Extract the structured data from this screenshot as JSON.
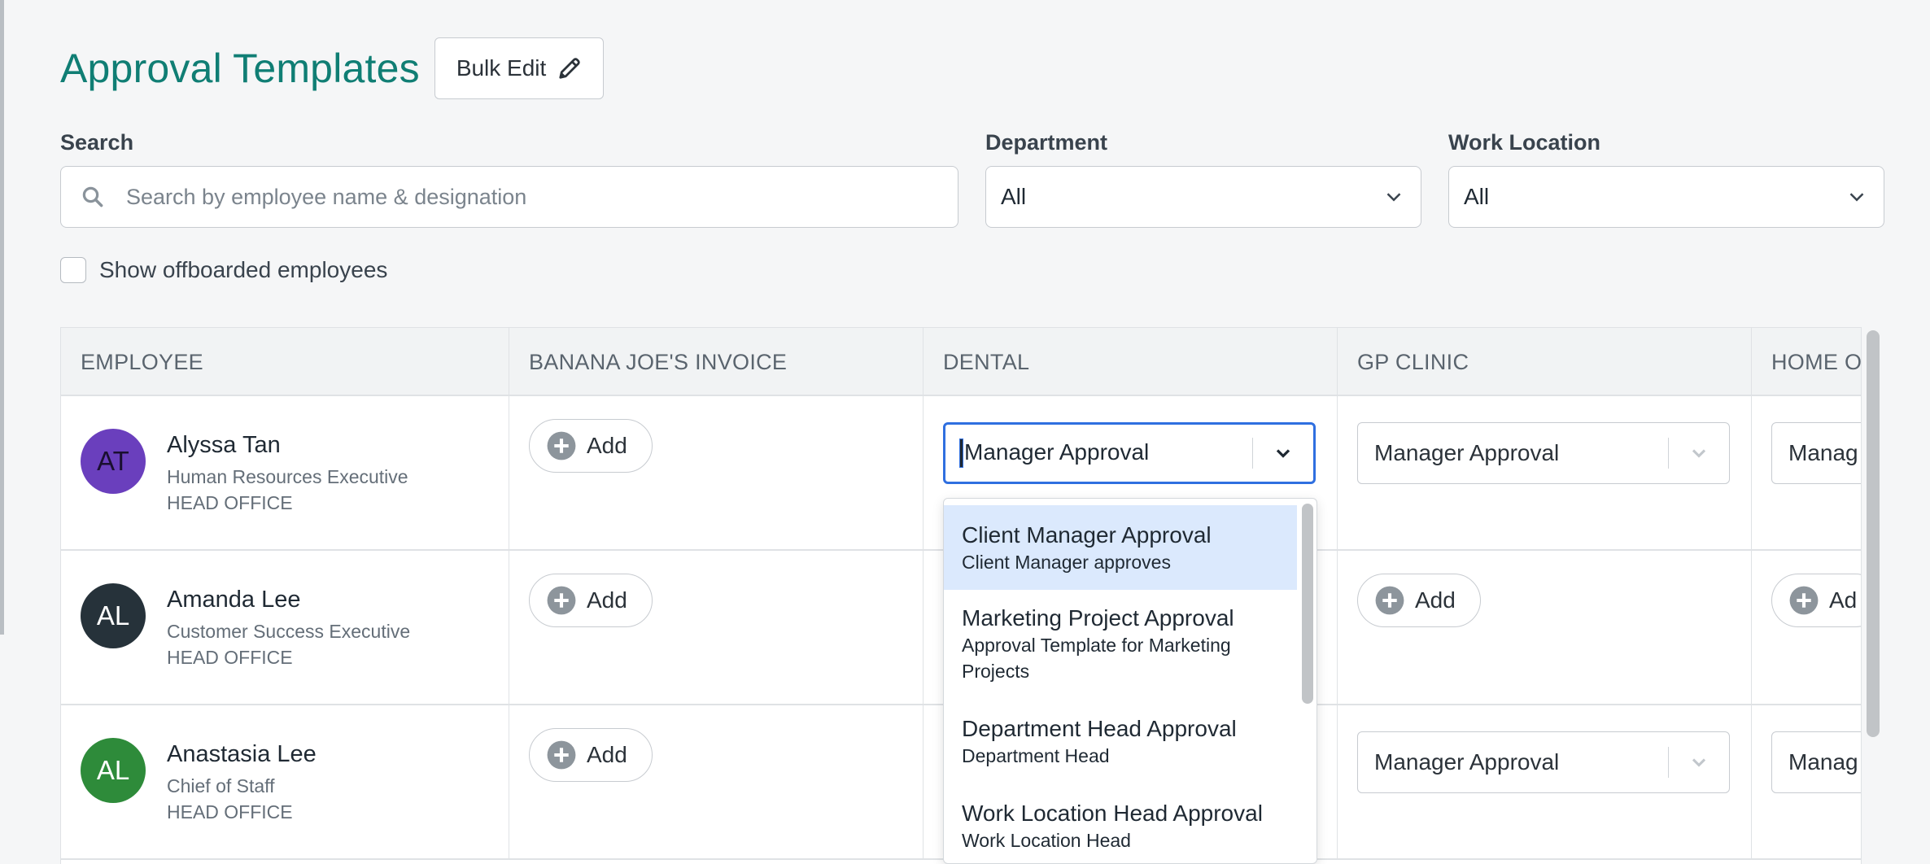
{
  "header": {
    "title": "Approval Templates",
    "bulk_edit_label": "Bulk Edit"
  },
  "filters": {
    "search_label": "Search",
    "search_placeholder": "Search by employee name & designation",
    "department_label": "Department",
    "department_value": "All",
    "work_location_label": "Work Location",
    "work_location_value": "All",
    "offboarded_label": "Show offboarded employees"
  },
  "table": {
    "columns": [
      "EMPLOYEE",
      "BANANA JOE'S INVOICE",
      "DENTAL",
      "GP CLINIC",
      "HOME OF"
    ],
    "add_label": "Add",
    "rows": [
      {
        "initials": "AT",
        "avatar_color": "#6a3fbd",
        "name": "Alyssa Tan",
        "title": "Human Resources Executive",
        "location": "HEAD OFFICE",
        "dental": "Manager Approval",
        "gp_clinic": "Manager Approval",
        "home_office": "Manag"
      },
      {
        "initials": "AL",
        "avatar_color": "#26323a",
        "name": "Amanda Lee",
        "title": "Customer Success Executive",
        "location": "HEAD OFFICE",
        "home_office_add": "Ad"
      },
      {
        "initials": "AL",
        "avatar_color": "#2e8b3a",
        "name": "Anastasia Lee",
        "title": "Chief of Staff",
        "location": "HEAD OFFICE",
        "gp_clinic": "Manager Approval",
        "home_office": "Manag"
      }
    ]
  },
  "dropdown": {
    "options": [
      {
        "title": "Client Manager Approval",
        "subtitle": "Client Manager approves"
      },
      {
        "title": "Marketing Project Approval",
        "subtitle_line1": "Approval Template for Marketing",
        "subtitle_line2": "Projects"
      },
      {
        "title": "Department Head Approval",
        "subtitle": "Department Head"
      },
      {
        "title": "Work Location Head Approval",
        "subtitle": "Work Location Head"
      }
    ]
  },
  "colors": {
    "accent": "#107e74",
    "focus": "#2f6fe0",
    "highlight": "#dbe9fd"
  }
}
